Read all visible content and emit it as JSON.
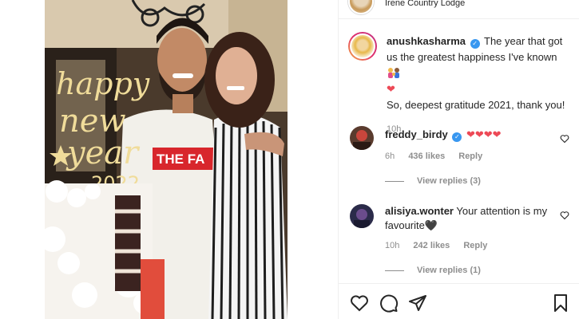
{
  "post": {
    "location": "Irene Country Lodge",
    "photo_alt": "",
    "cake_text_line1": "happy",
    "cake_text_line2": "new",
    "cake_text_line3": "year",
    "cake_year": "2022",
    "shirt_text": "THE FA"
  },
  "caption": {
    "username": "anushkasharma",
    "verified": "✓",
    "text_line1": "The year that got us the greatest happiness I've known",
    "heart": "❤",
    "text_line2": "So, deepest gratitude 2021, thank you!",
    "time": "10h"
  },
  "comments": [
    {
      "username": "freddy_birdy",
      "verified": "✓",
      "text": "❤❤❤❤",
      "time": "6h",
      "likes": "436 likes",
      "reply": "Reply",
      "view_replies": "View replies (3)"
    },
    {
      "username": "alisiya.wonter",
      "text": "Your attention is my favourite🖤",
      "time": "10h",
      "likes": "242 likes",
      "reply": "Reply",
      "view_replies": "View replies (1)"
    }
  ],
  "actions": {
    "like_icon": "heart-outline-icon",
    "comment_icon": "comment-bubble-icon",
    "share_icon": "paper-plane-icon",
    "save_icon": "bookmark-icon"
  }
}
